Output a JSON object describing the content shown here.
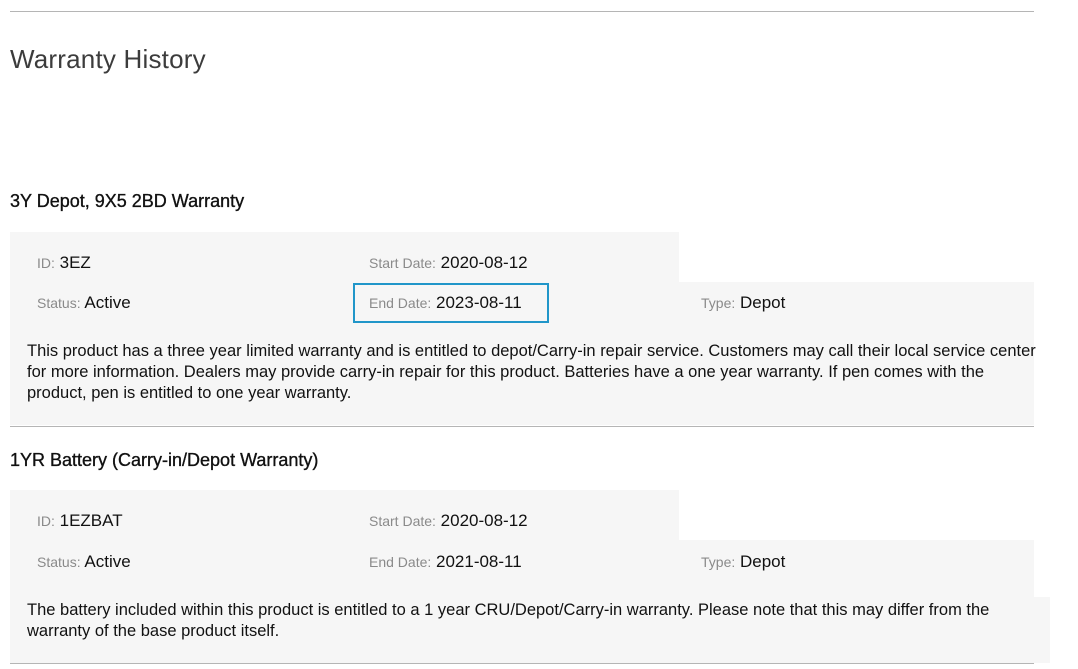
{
  "page": {
    "title": "Warranty History"
  },
  "labels": {
    "id": "ID:",
    "start_date": "Start Date:",
    "end_date": "End Date:",
    "status": "Status:",
    "type": "Type:"
  },
  "warranties": [
    {
      "name": "3Y Depot, 9X5 2BD Warranty",
      "id": "3EZ",
      "start_date": "2020-08-12",
      "end_date": "2023-08-11",
      "status": "Active",
      "type": "Depot",
      "description": "This product has a three year limited warranty and is entitled to depot/Carry-in repair service. Customers may call their local service center for more information. Dealers may provide carry-in repair for this product. Batteries have a one year warranty. If pen comes with the product, pen is entitled to one year warranty."
    },
    {
      "name": "1YR Battery (Carry-in/Depot Warranty)",
      "id": "1EZBAT",
      "start_date": "2020-08-12",
      "end_date": "2021-08-11",
      "status": "Active",
      "type": "Depot",
      "description": "The battery included within this product is entitled to a 1 year CRU/Depot/Carry-in warranty. Please note that this may differ from the warranty of the base product itself."
    }
  ],
  "colors": {
    "highlight": "#2196c9",
    "panel_bg": "#f6f6f6",
    "label": "#8a8a8a",
    "rule": "#b5b5b5"
  }
}
